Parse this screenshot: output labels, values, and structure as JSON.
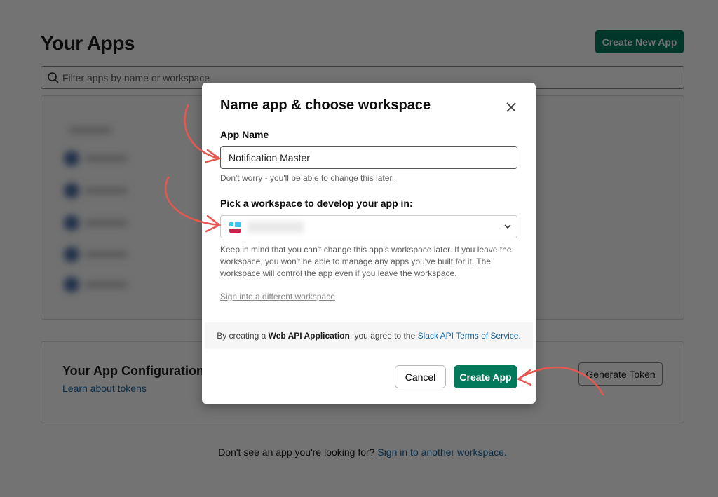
{
  "page": {
    "title": "Your Apps",
    "create_new_label": "Create New App",
    "filter_placeholder": "Filter apps by name or workspace",
    "config": {
      "title": "Your App Configuration Tokens",
      "learn_link": "Learn about tokens",
      "generate_label": "Generate Token"
    },
    "footer": {
      "text": "Don't see an app you're looking for?",
      "link": "Sign in to another workspace."
    }
  },
  "modal": {
    "title": "Name app & choose workspace",
    "app_name_label": "App Name",
    "app_name_value": "Notification Master",
    "app_name_hint": "Don't worry - you'll be able to change this later.",
    "workspace_label": "Pick a workspace to develop your app in:",
    "workspace_hint": "Keep in mind that you can't change this app's workspace later. If you leave the workspace, you won't be able to manage any apps you've built for it. The workspace will control the app even if you leave the workspace.",
    "signin_link": "Sign into a different workspace",
    "terms_prefix": "By creating a",
    "terms_bold": "Web API Application",
    "terms_middle": ", you agree to the",
    "terms_link": "Slack API Terms of Service.",
    "cancel_label": "Cancel",
    "create_label": "Create App"
  },
  "colors": {
    "accent": "#007a5a",
    "link": "#1264a3",
    "annotation": "#e8574f"
  }
}
